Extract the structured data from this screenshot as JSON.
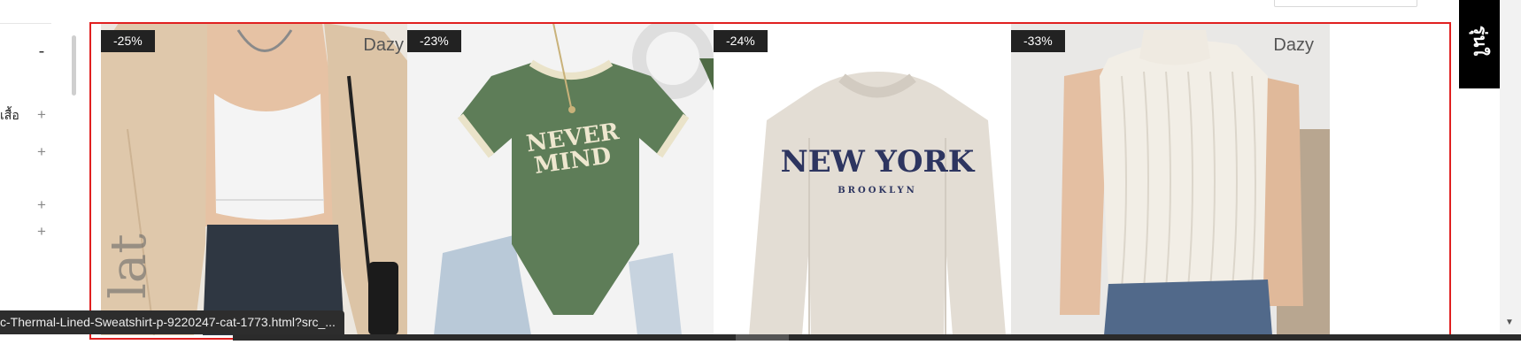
{
  "sidebar": {
    "collapse_symbol": "-",
    "rows": [
      {
        "label": "เสื้อ",
        "toggle": "+"
      },
      {
        "label": "",
        "toggle": "+"
      },
      {
        "label": "",
        "toggle": "+"
      },
      {
        "label": "",
        "toggle": "+"
      }
    ]
  },
  "products": [
    {
      "discount": "-25%",
      "brand": "Dazy",
      "image": "beige-cardigan-crop-top-photo"
    },
    {
      "discount": "-23%",
      "brand": "",
      "image": "green-never-mind-bodysuit-photo"
    },
    {
      "discount": "-24%",
      "brand": "",
      "image": "new-york-brooklyn-sweatshirt-photo"
    },
    {
      "discount": "-33%",
      "brand": "Dazy",
      "image": "white-textured-sleeveless-top-photo"
    }
  ],
  "shirt_prints": {
    "line1": "NEVER",
    "line2": "MIND",
    "sweat_line1": "NEW YORK",
    "sweat_line2": "BROOKLYN"
  },
  "side_tab": {
    "label": "รุ่นใ"
  },
  "status_bar": {
    "url": "c-Thermal-Lined-Sweatshirt-p-9220247-cat-1773.html?src_..."
  },
  "colors": {
    "highlight": "#e02020",
    "badge": "#222222",
    "side_tab": "#000000"
  }
}
